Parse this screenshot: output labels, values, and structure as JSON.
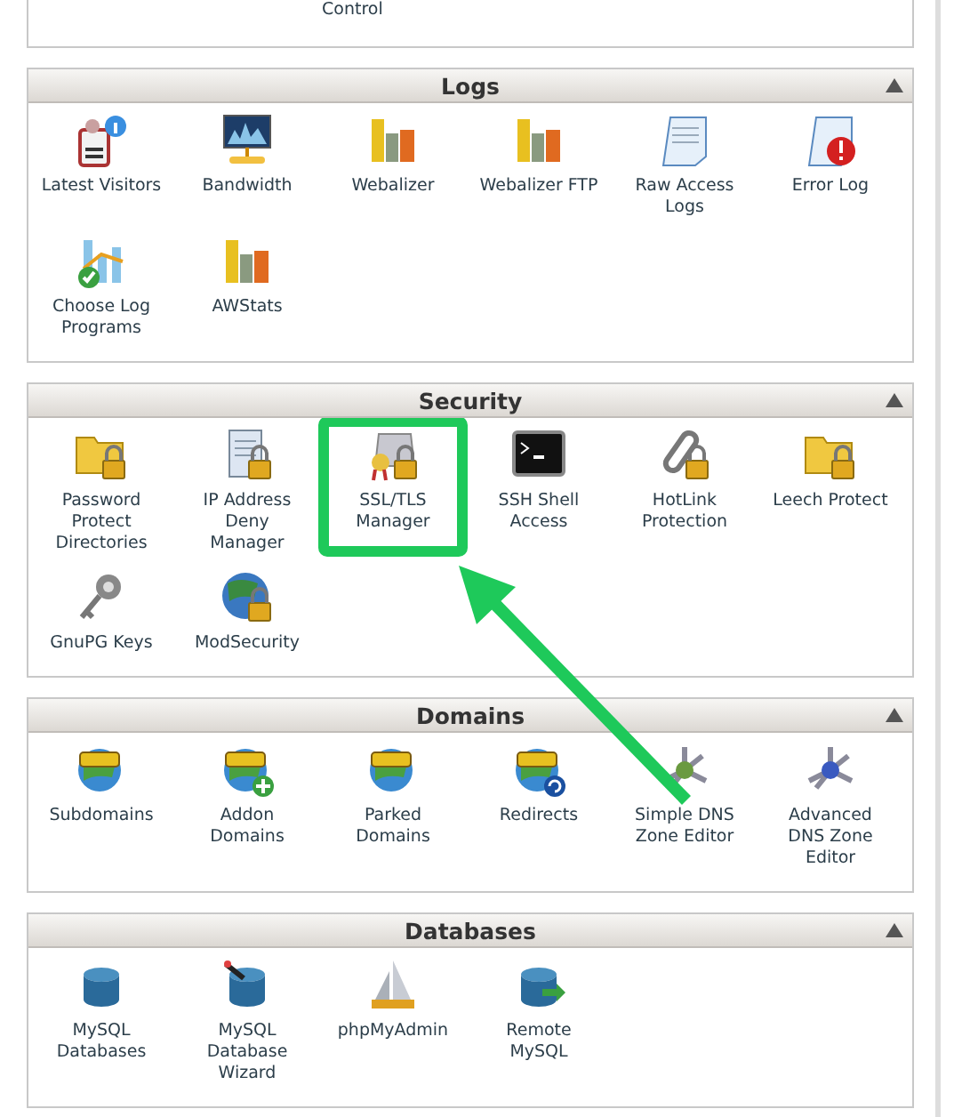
{
  "previous_panel": {
    "item_label": "Control"
  },
  "sections": [
    {
      "title": "Logs",
      "items": [
        {
          "label": "Latest Visitors",
          "highlighted": false
        },
        {
          "label": "Bandwidth",
          "highlighted": false
        },
        {
          "label": "Webalizer",
          "highlighted": false
        },
        {
          "label": "Webalizer FTP",
          "highlighted": false
        },
        {
          "label": "Raw Access Logs",
          "highlighted": false
        },
        {
          "label": "Error Log",
          "highlighted": false
        },
        {
          "label": "Choose Log Programs",
          "highlighted": false
        },
        {
          "label": "AWStats",
          "highlighted": false
        }
      ]
    },
    {
      "title": "Security",
      "items": [
        {
          "label": "Password Protect Directories",
          "highlighted": false
        },
        {
          "label": "IP Address Deny Manager",
          "highlighted": false
        },
        {
          "label": "SSL/TLS Manager",
          "highlighted": true
        },
        {
          "label": "SSH Shell Access",
          "highlighted": false
        },
        {
          "label": "HotLink Protection",
          "highlighted": false
        },
        {
          "label": "Leech Protect",
          "highlighted": false
        },
        {
          "label": "GnuPG Keys",
          "highlighted": false
        },
        {
          "label": "ModSecurity",
          "highlighted": false
        }
      ]
    },
    {
      "title": "Domains",
      "items": [
        {
          "label": "Subdomains",
          "highlighted": false
        },
        {
          "label": "Addon Domains",
          "highlighted": false
        },
        {
          "label": "Parked Domains",
          "highlighted": false
        },
        {
          "label": "Redirects",
          "highlighted": false
        },
        {
          "label": "Simple DNS Zone Editor",
          "highlighted": false
        },
        {
          "label": "Advanced DNS Zone Editor",
          "highlighted": false
        }
      ]
    },
    {
      "title": "Databases",
      "items": [
        {
          "label": "MySQL Databases",
          "highlighted": false
        },
        {
          "label": "MySQL Database Wizard",
          "highlighted": false
        },
        {
          "label": "phpMyAdmin",
          "highlighted": false
        },
        {
          "label": "Remote MySQL",
          "highlighted": false
        }
      ]
    }
  ]
}
